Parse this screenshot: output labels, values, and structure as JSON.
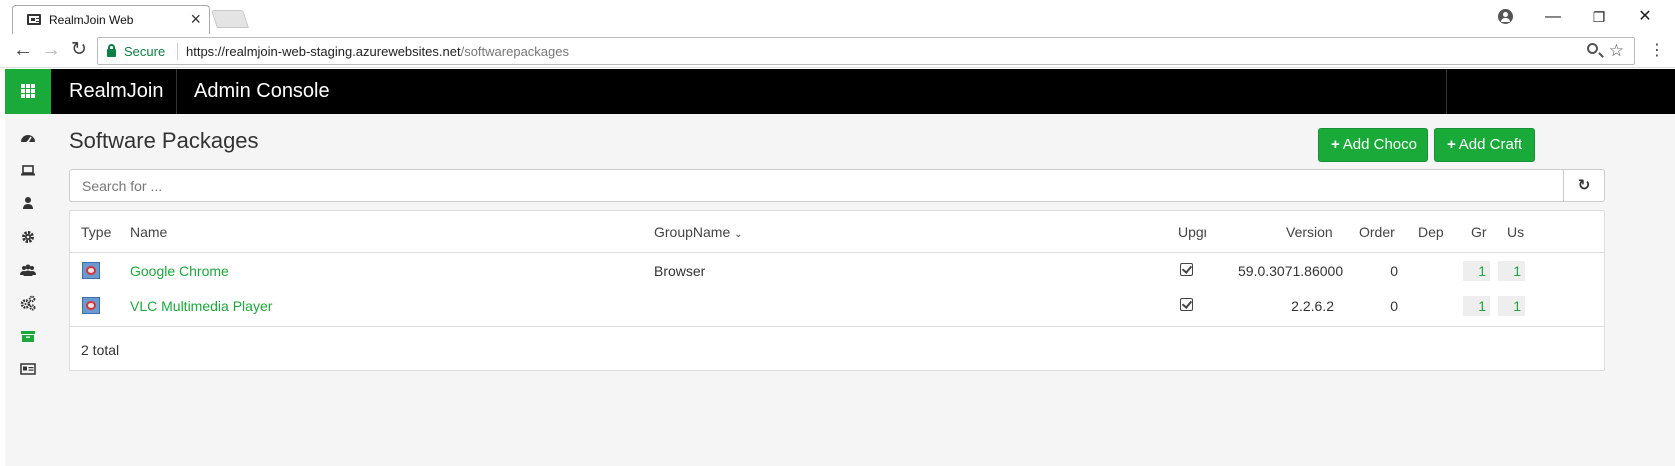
{
  "browser": {
    "tab_title": "RealmJoin Web",
    "tab_close": "×",
    "window_controls": {
      "minimize": "—",
      "restore": "❐",
      "close": "✕"
    },
    "secure_label": "Secure",
    "url_host": "https://realmjoin-web-staging.azurewebsites.net",
    "url_path": "/softwarepackages",
    "icons": [
      "back-icon",
      "forward-icon",
      "reload-icon",
      "lock-icon",
      "zoom-icon",
      "star-icon",
      "menu-icon",
      "profile-icon"
    ]
  },
  "header": {
    "brand": "RealmJoin",
    "section": "Admin Console",
    "accent_color": "#1aaa3a",
    "bar_color": "#000000"
  },
  "sidebar": {
    "items": [
      {
        "icon": "dashboard-icon",
        "active": false
      },
      {
        "icon": "laptop-icon",
        "active": false
      },
      {
        "icon": "user-icon",
        "active": false
      },
      {
        "icon": "gear-icon",
        "active": false
      },
      {
        "icon": "users-icon",
        "active": false
      },
      {
        "icon": "gears-icon",
        "active": false
      },
      {
        "icon": "archive-icon",
        "active": true
      },
      {
        "icon": "id-card-icon",
        "active": false
      }
    ]
  },
  "page": {
    "title": "Software Packages",
    "add_choco_label": "Add Choco",
    "add_craft_label": "Add Craft",
    "search_placeholder": "Search for ..."
  },
  "table": {
    "columns": {
      "type": "Type",
      "name": "Name",
      "group": "GroupName",
      "upgrade": "Upgr",
      "version": "Version",
      "order": "Order",
      "dep": "Dep",
      "groups": "Gr",
      "users": "Us"
    },
    "rows": [
      {
        "name": "Google Chrome",
        "group": "Browser",
        "upgrade": true,
        "version": "59.0.3071.86000",
        "order": "0",
        "groups": "1",
        "users": "1"
      },
      {
        "name": "VLC Multimedia Player",
        "group": "",
        "upgrade": true,
        "version": "2.2.6.2",
        "order": "0",
        "groups": "1",
        "users": "1"
      }
    ],
    "total_text": "2 total"
  }
}
